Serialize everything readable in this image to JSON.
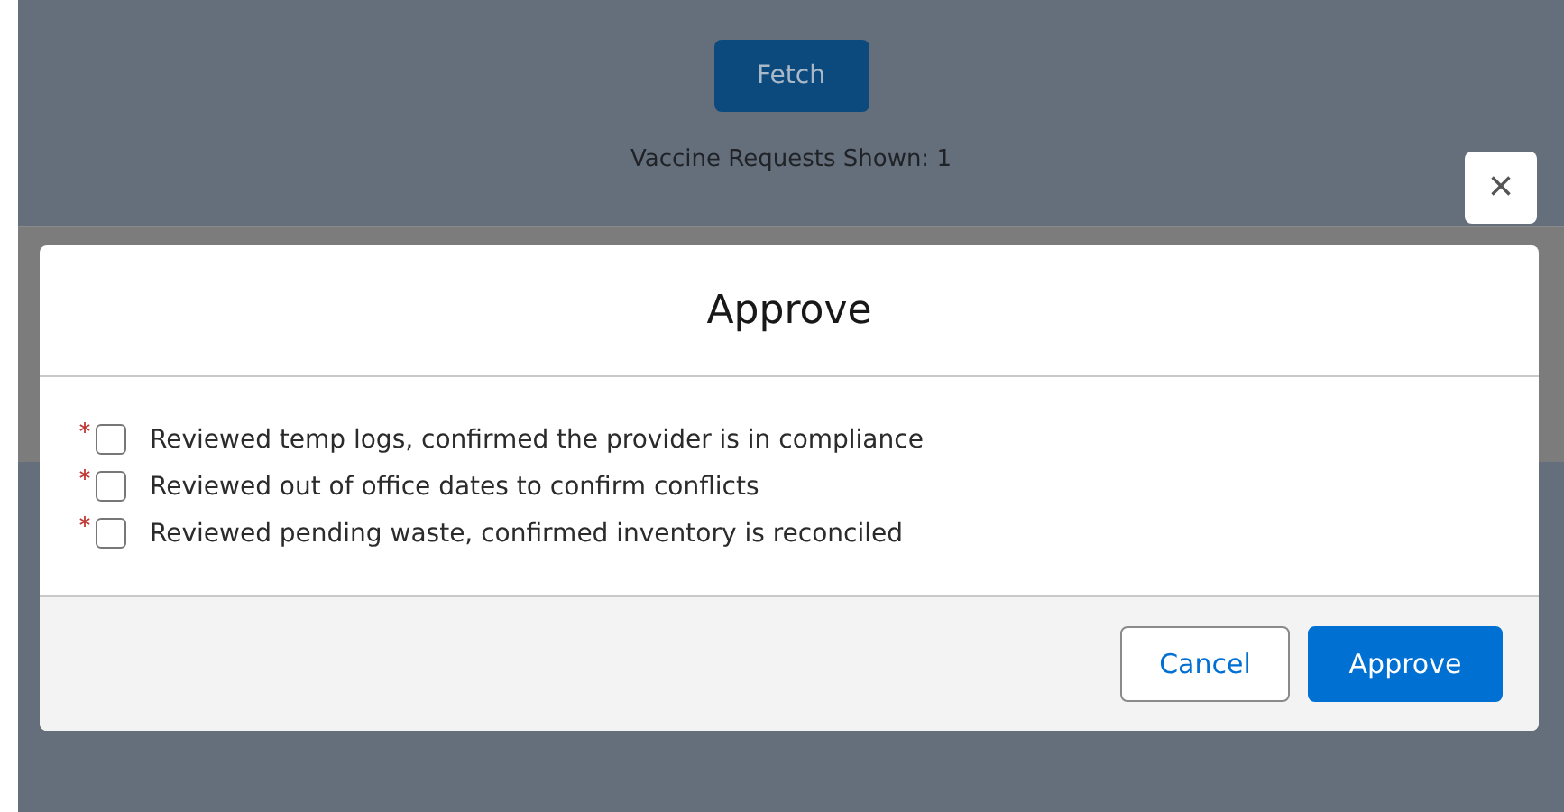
{
  "page": {
    "fetch_button": "Fetch",
    "count_text": "Vaccine Requests Shown: 1"
  },
  "modal": {
    "close": "×",
    "title": "Approve",
    "checks": [
      {
        "label": "Reviewed temp logs, confirmed the provider is in compliance",
        "required": true,
        "checked": false
      },
      {
        "label": "Reviewed out of office dates to confirm conflicts",
        "required": true,
        "checked": false
      },
      {
        "label": "Reviewed pending waste, confirmed inventory is reconciled",
        "required": true,
        "checked": false
      }
    ],
    "buttons": [
      {
        "label": "Cancel",
        "kind": "neutral"
      },
      {
        "label": "Approve",
        "kind": "brand"
      }
    ]
  }
}
